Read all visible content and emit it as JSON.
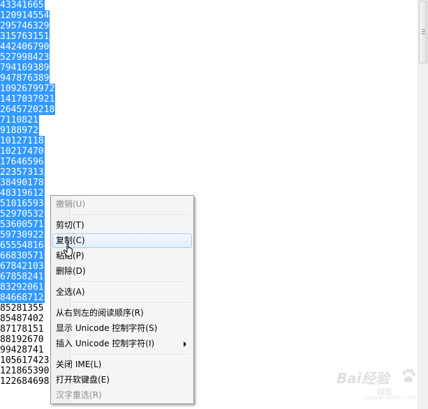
{
  "editor": {
    "lines": [
      {
        "text": "43341665",
        "selected": true
      },
      {
        "text": "120914554",
        "selected": true
      },
      {
        "text": "295746329",
        "selected": true
      },
      {
        "text": "315763151",
        "selected": true
      },
      {
        "text": "442406790",
        "selected": true
      },
      {
        "text": "527998423",
        "selected": true
      },
      {
        "text": "794169389",
        "selected": true
      },
      {
        "text": "947876389",
        "selected": true
      },
      {
        "text": "1092679972",
        "selected": true
      },
      {
        "text": "1417037921",
        "selected": true
      },
      {
        "text": "2645720218",
        "selected": true
      },
      {
        "text": "7110821",
        "selected": true
      },
      {
        "text": "9188972",
        "selected": true
      },
      {
        "text": "10127118",
        "selected": true
      },
      {
        "text": "10217470",
        "selected": true
      },
      {
        "text": "17646596",
        "selected": true
      },
      {
        "text": "22357313",
        "selected": true
      },
      {
        "text": "38490178",
        "selected": true
      },
      {
        "text": "48319612",
        "selected": true
      },
      {
        "text": "51016593",
        "selected": true
      },
      {
        "text": "52970532",
        "selected": true
      },
      {
        "text": "53600571",
        "selected": true
      },
      {
        "text": "59730922",
        "selected": true
      },
      {
        "text": "65554816",
        "selected": true
      },
      {
        "text": "66830571",
        "selected": true
      },
      {
        "text": "67842103",
        "selected": true
      },
      {
        "text": "67858241",
        "selected": true
      },
      {
        "text": "83292061",
        "selected": true
      },
      {
        "text": "84668712",
        "selected": true
      },
      {
        "text": "85281355",
        "selected": false
      },
      {
        "text": "85487402",
        "selected": false
      },
      {
        "text": "87178151",
        "selected": false
      },
      {
        "text": "88192670",
        "selected": false
      },
      {
        "text": "99428741",
        "selected": false
      },
      {
        "text": "105617423",
        "selected": false
      },
      {
        "text": "121865390",
        "selected": false
      },
      {
        "text": "122684698",
        "selected": false
      }
    ]
  },
  "context_menu": {
    "items": [
      {
        "type": "item",
        "label": "撤销(U)",
        "name": "menu-item-undo",
        "disabled": true
      },
      {
        "type": "separator"
      },
      {
        "type": "item",
        "label": "剪切(T)",
        "name": "menu-item-cut"
      },
      {
        "type": "item",
        "label": "复制(C)",
        "name": "menu-item-copy",
        "hover": true
      },
      {
        "type": "item",
        "label": "粘贴(P)",
        "name": "menu-item-paste"
      },
      {
        "type": "item",
        "label": "删除(D)",
        "name": "menu-item-delete"
      },
      {
        "type": "separator"
      },
      {
        "type": "item",
        "label": "全选(A)",
        "name": "menu-item-select-all"
      },
      {
        "type": "separator"
      },
      {
        "type": "item",
        "label": "从右到左的阅读顺序(R)",
        "name": "menu-item-rtl-reading-order"
      },
      {
        "type": "item",
        "label": "显示 Unicode 控制字符(S)",
        "name": "menu-item-show-unicode-control"
      },
      {
        "type": "item",
        "label": "插入 Unicode 控制字符(I)",
        "name": "menu-item-insert-unicode-control",
        "submenu": true
      },
      {
        "type": "separator"
      },
      {
        "type": "item",
        "label": "关闭 IME(L)",
        "name": "menu-item-close-ime"
      },
      {
        "type": "item",
        "label": "打开软键盘(E)",
        "name": "menu-item-open-soft-keyboard"
      },
      {
        "type": "item",
        "label": "汉字重选(R)",
        "name": "menu-item-reconvert",
        "disabled": true
      }
    ]
  },
  "colors": {
    "selection": "#3399ff",
    "menu_background": "#f5f5f5",
    "menu_hover": "#e3eefc",
    "disabled_text": "#8c8c8c"
  },
  "watermark": {
    "brand": "Bai经验",
    "sub": "经验",
    "url": "jingyan.baidu.com"
  }
}
